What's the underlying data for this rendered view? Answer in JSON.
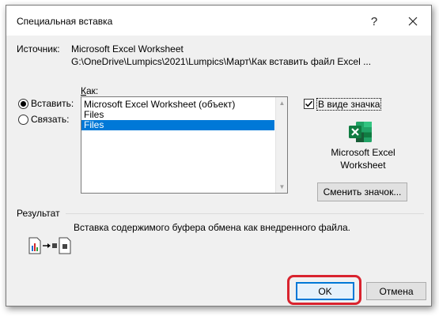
{
  "window": {
    "title": "Специальная вставка",
    "help_label": "?"
  },
  "source": {
    "label": "Источник:",
    "name": "Microsoft Excel Worksheet",
    "path": "G:\\OneDrive\\Lumpics\\2021\\Lumpics\\Март\\Как вставить файл Excel ..."
  },
  "as_label": "Как:",
  "options": {
    "paste_label": "Вставить:",
    "link_label": "Связать:",
    "selected": "paste"
  },
  "list": {
    "items": [
      "Microsoft Excel Worksheet (объект)",
      "Files",
      "Files"
    ],
    "selected_index": 2
  },
  "display_as_icon": {
    "label": "В виде значка",
    "checked": true,
    "icon_caption_line1": "Microsoft Excel",
    "icon_caption_line2": "Worksheet",
    "change_icon_label": "Сменить значок..."
  },
  "result": {
    "label": "Результат",
    "text": "Вставка содержимого буфера обмена как внедренного файла."
  },
  "buttons": {
    "ok": "OK",
    "cancel": "Отмена"
  },
  "colors": {
    "accent": "#0078d7",
    "highlight": "#d9232e",
    "excel_green": "#107c41"
  }
}
